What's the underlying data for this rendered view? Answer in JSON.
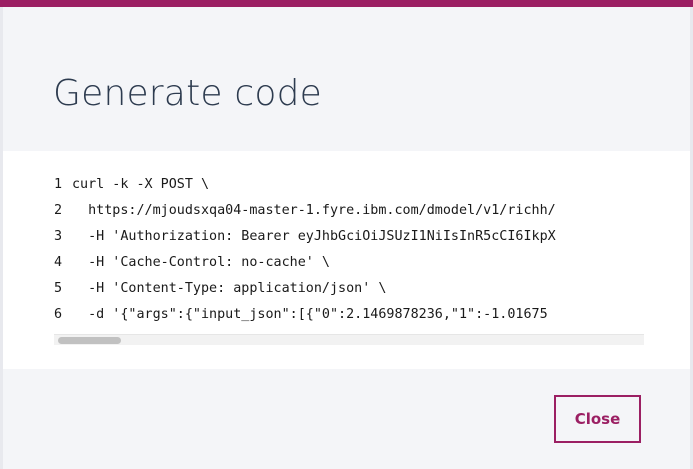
{
  "dialog": {
    "title": "Generate code",
    "close_label": "Close"
  },
  "code": {
    "lines": [
      {
        "num": "1",
        "text": "curl -k -X POST \\"
      },
      {
        "num": "2",
        "text": "  https://mjoudsxqa04-master-1.fyre.ibm.com/dmodel/v1/richh/"
      },
      {
        "num": "3",
        "text": "  -H 'Authorization: Bearer eyJhbGciOiJSUzI1NiIsInR5cCI6IkpX"
      },
      {
        "num": "4",
        "text": "  -H 'Cache-Control: no-cache' \\"
      },
      {
        "num": "5",
        "text": "  -H 'Content-Type: application/json' \\"
      },
      {
        "num": "6",
        "text": "  -d '{\"args\":{\"input_json\":[{\"0\":2.1469878236,\"1\":-1.01675"
      }
    ]
  },
  "colors": {
    "accent": "#9b1f63",
    "title_text": "#2d3b4f",
    "background": "#f4f5f8"
  }
}
